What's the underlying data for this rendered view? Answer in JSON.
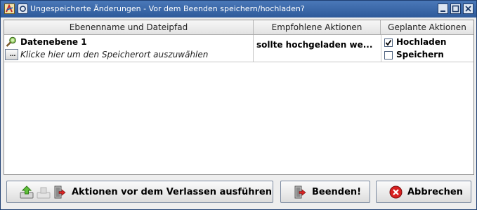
{
  "window": {
    "title": "Ungespeicherte Änderungen - Vor dem Beenden speichern/hochladen?",
    "colors": {
      "titlebar": "#3a6aa9",
      "close_button": "#cc1f1f"
    }
  },
  "table": {
    "columns": [
      "Ebenenname und Dateipfad",
      "Empfohlene Aktionen",
      "Geplante Aktionen"
    ],
    "rows": [
      {
        "layer_name": "Datenebene 1",
        "path_button": "...",
        "path_hint": "Klicke hier um den Speicherort auszuwählen",
        "recommended": "sollte hochgeladen we...",
        "upload_label": "Hochladen",
        "upload_checked": true,
        "save_label": "Speichern",
        "save_checked": false
      }
    ]
  },
  "buttons": {
    "perform": "Aktionen vor dem Verlassen ausführen",
    "exit": "Beenden!",
    "cancel": "Abbrechen"
  }
}
